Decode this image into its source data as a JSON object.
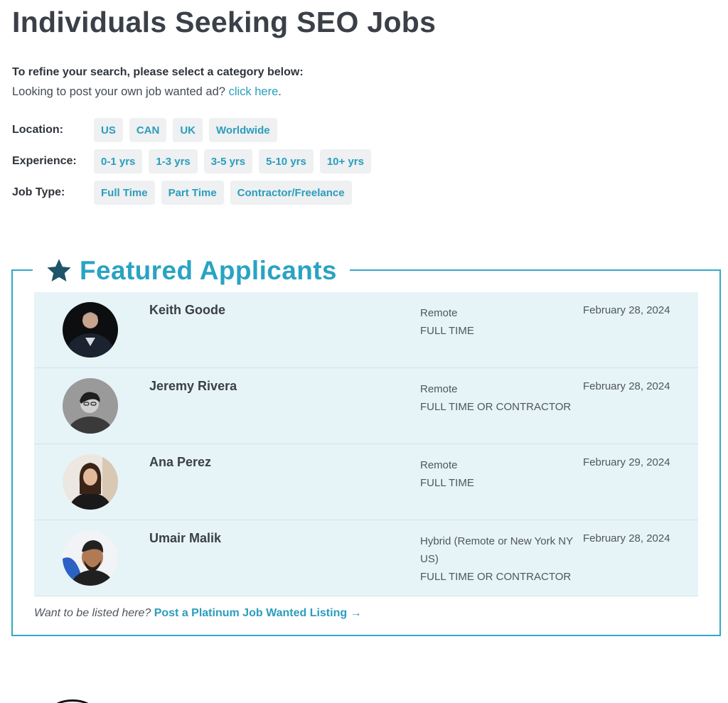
{
  "page": {
    "title": "Individuals Seeking SEO Jobs",
    "refine_text": "To refine your search, please select a category below:",
    "post_prefix": "Looking to post your own job wanted ad?",
    "post_link": "click here",
    "post_suffix": "."
  },
  "filters": {
    "location": {
      "label": "Location:",
      "options": [
        "US",
        "CAN",
        "UK",
        "Worldwide"
      ]
    },
    "experience": {
      "label": "Experience:",
      "options": [
        "0-1 yrs",
        "1-3 yrs",
        "3-5 yrs",
        "5-10 yrs",
        "10+ yrs"
      ]
    },
    "job_type": {
      "label": "Job Type:",
      "options": [
        "Full Time",
        "Part Time",
        "Contractor/Freelance"
      ]
    }
  },
  "featured": {
    "title": "Featured Applicants",
    "icon": "star-icon",
    "applicants": [
      {
        "name": "Keith Goode",
        "location": "Remote",
        "type": "FULL TIME",
        "date": "February 28, 2024"
      },
      {
        "name": "Jeremy Rivera",
        "location": "Remote",
        "type": "FULL TIME OR CONTRACTOR",
        "date": "February 28, 2024"
      },
      {
        "name": "Ana Perez",
        "location": "Remote",
        "type": "FULL TIME",
        "date": "February 29, 2024"
      },
      {
        "name": "Umair Malik",
        "location": "Hybrid (Remote or New York NY US)",
        "type": "FULL TIME OR CONTRACTOR",
        "date": "February 28, 2024"
      }
    ],
    "cta_prefix": "Want to be listed here?",
    "cta_link": "Post a Platinum Job Wanted Listing →"
  },
  "colors": {
    "accent": "#2aa3c2",
    "row_bg": "#e6f4f8",
    "chip_bg": "#eef0f1",
    "star": "#1e5568"
  }
}
